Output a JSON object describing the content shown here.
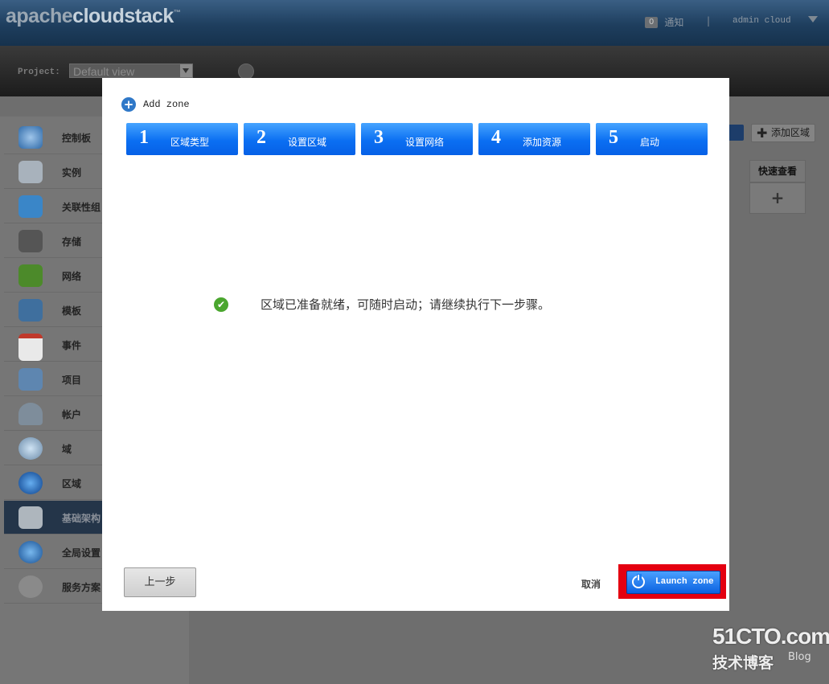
{
  "header": {
    "logo_part1": "apache",
    "logo_part2": "cloudstack",
    "logo_mark": "™",
    "notification_count": "0",
    "notification_label": "通知",
    "separator": "|",
    "user": "admin cloud"
  },
  "project": {
    "label": "Project:",
    "selected": "Default view"
  },
  "sidebar": {
    "items": [
      {
        "label": "控制板",
        "icon": "dashboard-icon"
      },
      {
        "label": "实例",
        "icon": "cloud-icon"
      },
      {
        "label": "关联性组",
        "icon": "affinity-cloud-icon"
      },
      {
        "label": "存储",
        "icon": "disk-icon"
      },
      {
        "label": "网络",
        "icon": "network-icon"
      },
      {
        "label": "模板",
        "icon": "template-icon"
      },
      {
        "label": "事件",
        "icon": "calendar-icon"
      },
      {
        "label": "项目",
        "icon": "folder-icon"
      },
      {
        "label": "帐户",
        "icon": "user-icon"
      },
      {
        "label": "域",
        "icon": "domain-icon"
      },
      {
        "label": "区域",
        "icon": "globe-icon"
      },
      {
        "label": "基础架构",
        "icon": "infrastructure-icon"
      },
      {
        "label": "全局设置",
        "icon": "global-settings-icon"
      },
      {
        "label": "服务方案",
        "icon": "gear-icon"
      }
    ]
  },
  "right_panel": {
    "add_zone_button": "添加区域",
    "quickview_header": "快速查看",
    "quickview_cell": "+"
  },
  "dialog": {
    "title": "Add zone",
    "steps": [
      {
        "num": "1",
        "label": "区域类型"
      },
      {
        "num": "2",
        "label": "设置区域"
      },
      {
        "num": "3",
        "label": "设置网络"
      },
      {
        "num": "4",
        "label": "添加资源"
      },
      {
        "num": "5",
        "label": "启动"
      }
    ],
    "ready_message": "区域已准备就绪，可随时启动；请继续执行下一步骤。",
    "prev_button": "上一步",
    "cancel": "取消",
    "launch_button": "Launch zone"
  },
  "watermark": {
    "line1": "51CTO.com",
    "line2": "技术博客",
    "line3": "Blog"
  },
  "colors": {
    "step_blue": "#0b6ff2",
    "highlight_red": "#e40010"
  }
}
